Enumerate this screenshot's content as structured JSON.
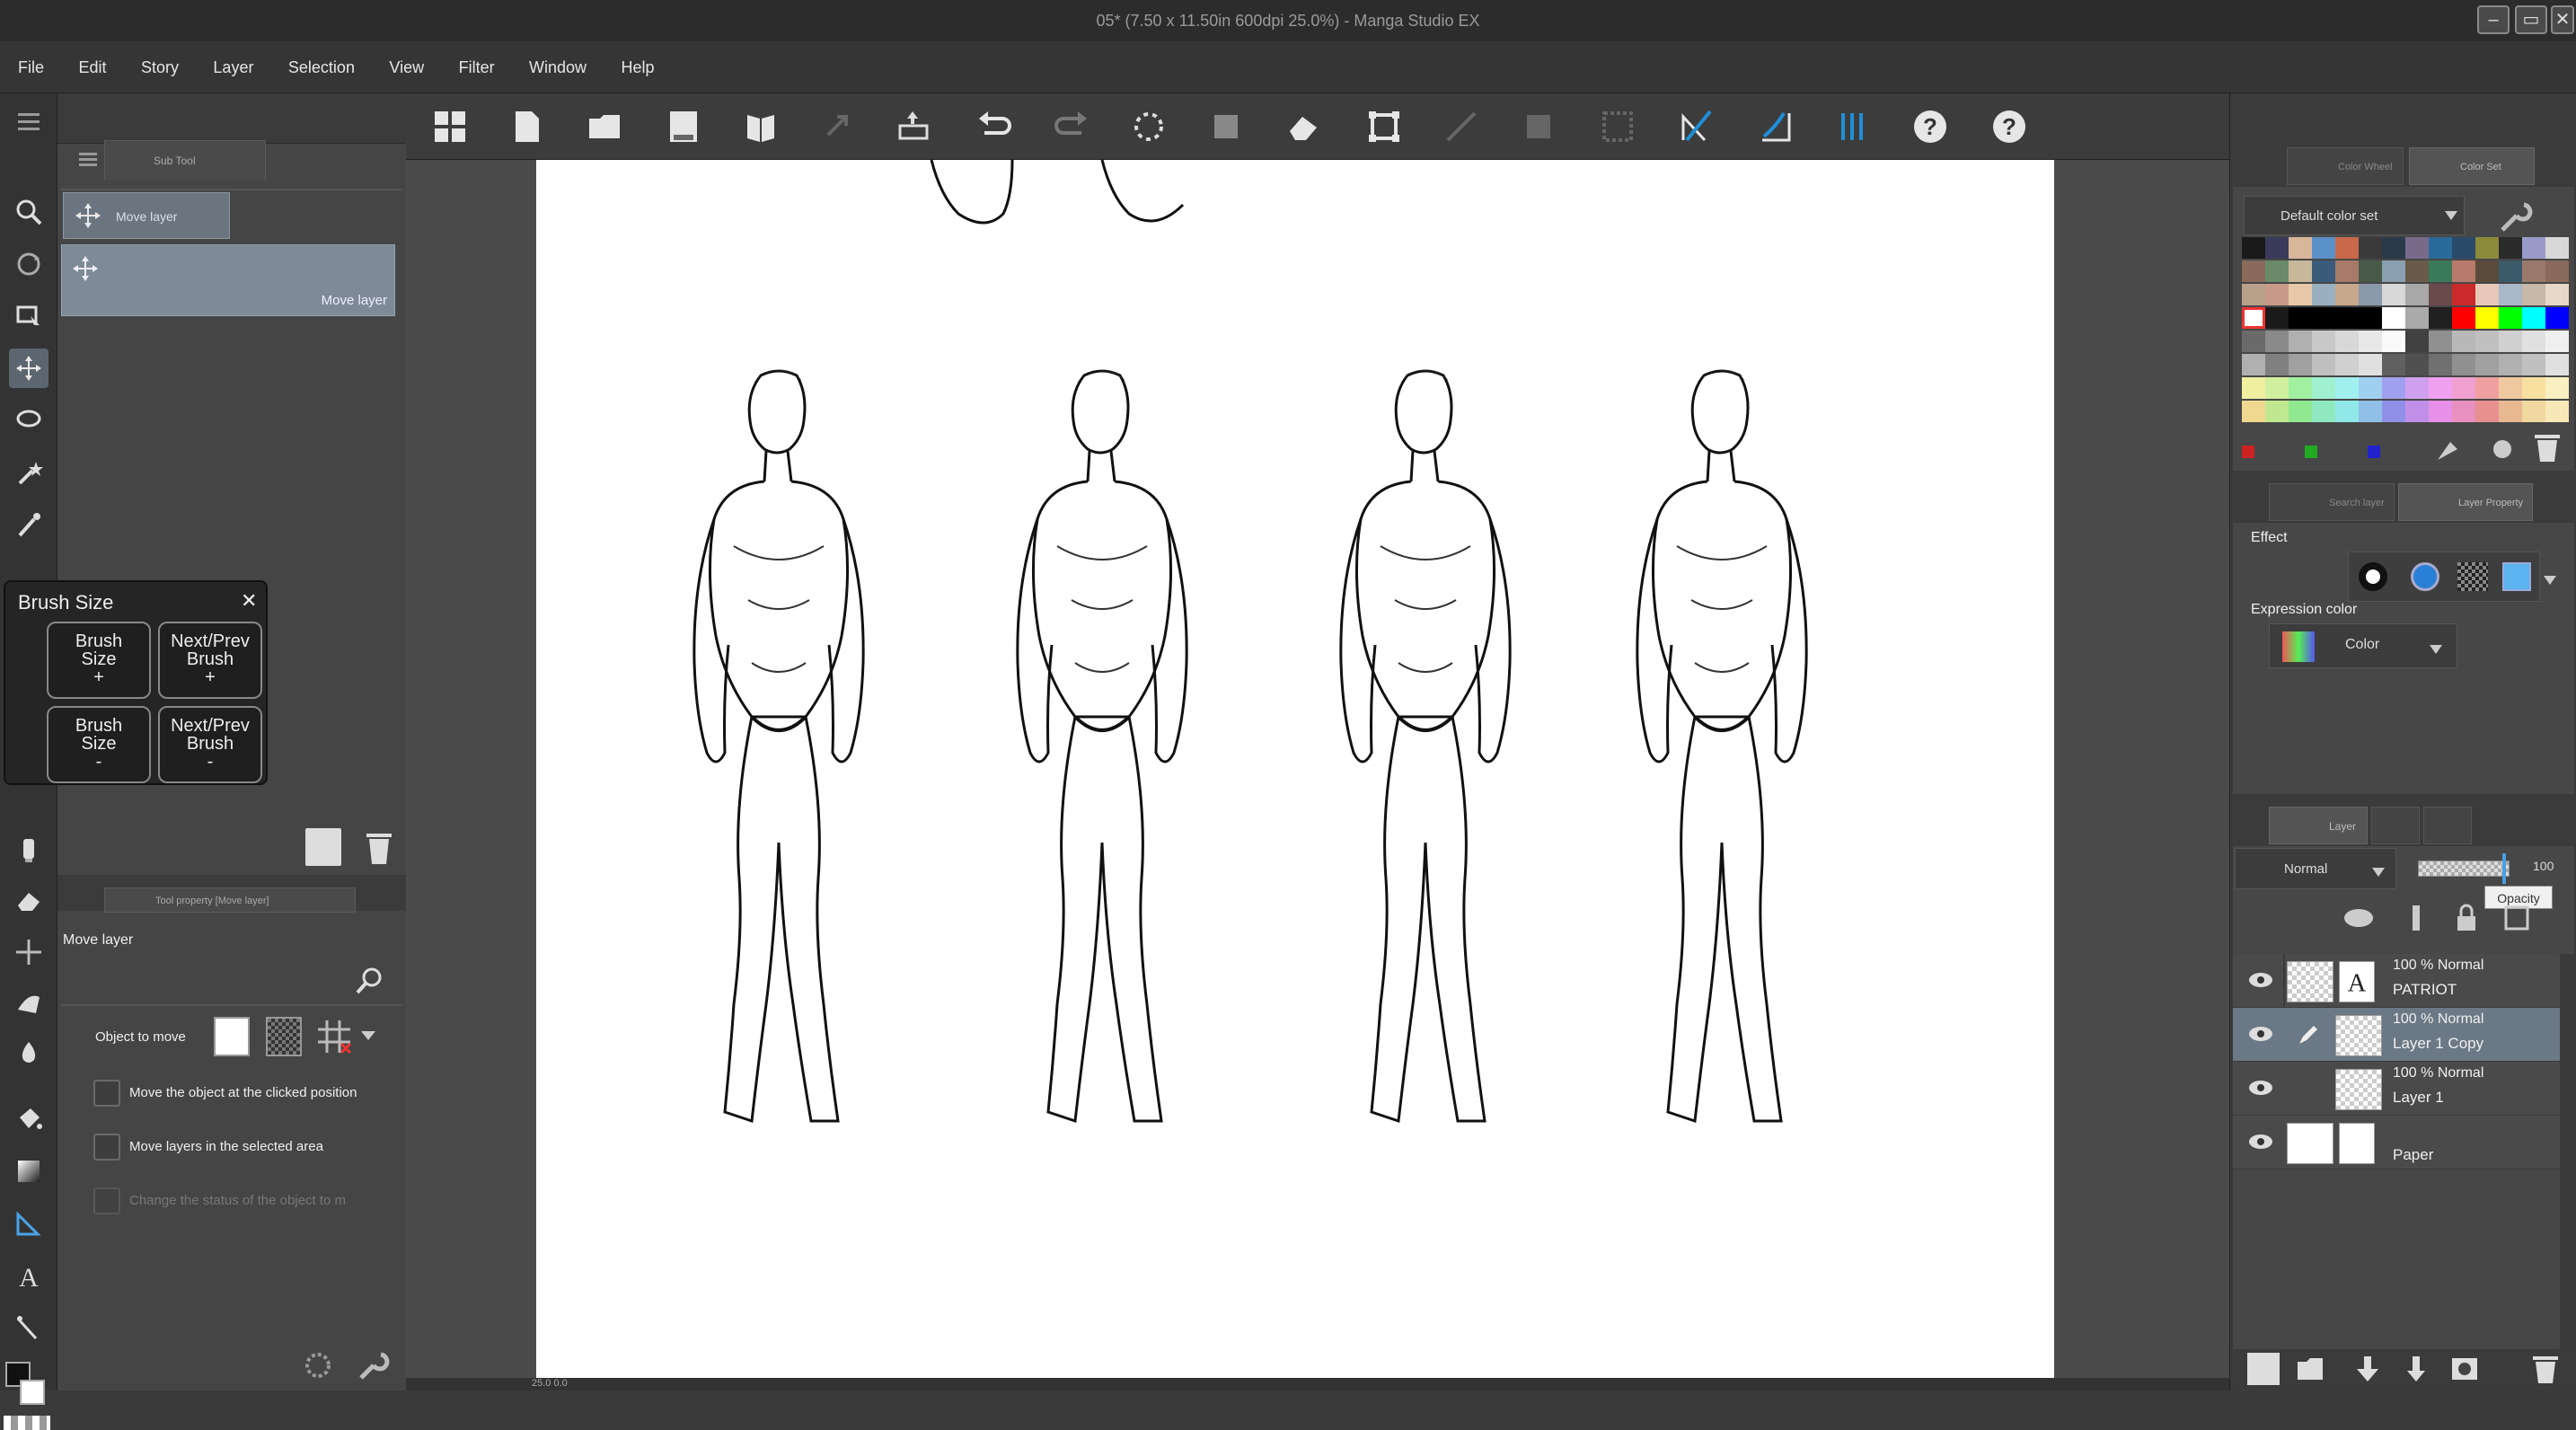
{
  "window": {
    "title": "05* (7.50 x 11.50in 600dpi 25.0%) - Manga Studio EX"
  },
  "menu": [
    "File",
    "Edit",
    "Story",
    "Layer",
    "Selection",
    "View",
    "Filter",
    "Window",
    "Help"
  ],
  "subtool_panel": {
    "tab_label": "Sub Tool",
    "group_label": "Move layer",
    "item_label": "Move layer"
  },
  "brush_popup": {
    "title": "Brush Size",
    "close": "✕",
    "buttons": [
      {
        "l1": "Brush",
        "l2": "Size",
        "l3": "+"
      },
      {
        "l1": "Next/Prev",
        "l2": "Brush",
        "l3": "+"
      },
      {
        "l1": "Brush",
        "l2": "Size",
        "l3": "-"
      },
      {
        "l1": "Next/Prev",
        "l2": "Brush",
        "l3": "-"
      }
    ]
  },
  "tool_property": {
    "tab_label": "Tool property [Move layer]",
    "title": "Move layer",
    "object_to_move": "Object to move",
    "option1": "Move the object at the clicked position",
    "option2": "Move layers in the selected area",
    "option3": "Change the status of the object to m"
  },
  "color_panel": {
    "tab1": "Color Wheel",
    "tab2": "Color Set",
    "set_name": "Default color set"
  },
  "layer_property": {
    "tab1": "Search layer",
    "tab2": "Layer Property",
    "effect_label": "Effect",
    "expression_label": "Expression color",
    "expression_value": "Color"
  },
  "layers_panel": {
    "tab1": "Layer",
    "blend_mode": "Normal",
    "opacity": "100",
    "tooltip": "Opacity",
    "layers": [
      {
        "meta": "100 %  Normal",
        "name": "PATRIOT",
        "selected": false
      },
      {
        "meta": "100 %  Normal",
        "name": "Layer 1 Copy",
        "selected": true
      },
      {
        "meta": "100 %  Normal",
        "name": "Layer 1",
        "selected": false
      },
      {
        "meta": "",
        "name": "Paper",
        "selected": false
      }
    ]
  },
  "status": {
    "zoom": "25.0  0.0"
  },
  "colors": {
    "accent": "#6b7885",
    "panel": "#474747",
    "highlight": "#1f8fd8"
  }
}
